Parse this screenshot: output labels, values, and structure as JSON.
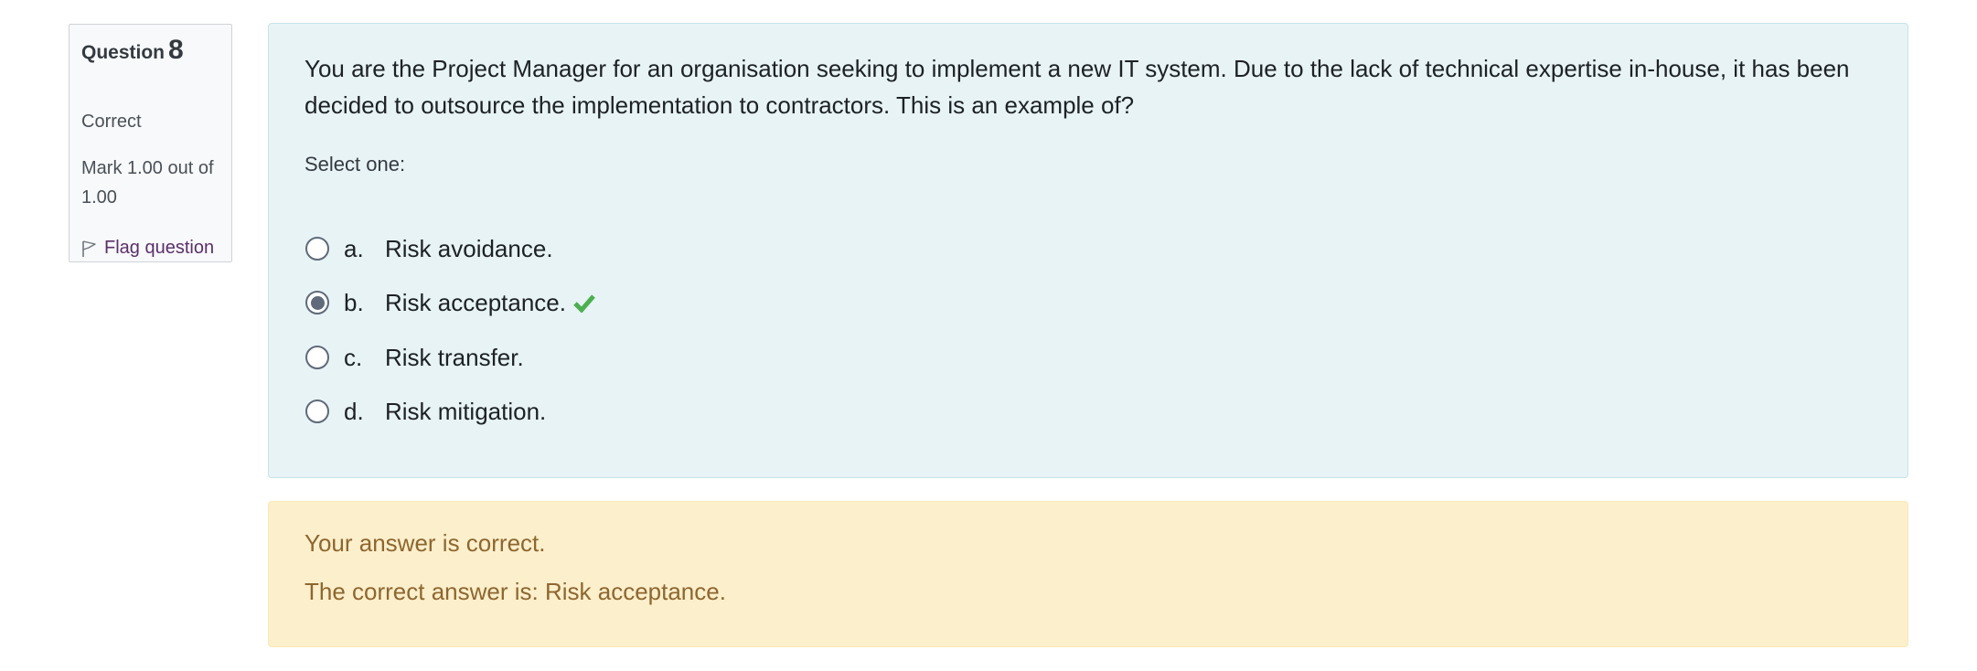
{
  "info": {
    "question_label": "Question",
    "question_number": "8",
    "state": "Correct",
    "grade": "Mark 1.00 out of 1.00",
    "flag_label": "Flag question",
    "flag_icon": "flag-icon"
  },
  "question": {
    "text": "You are the Project Manager for an organisation seeking to implement a new IT system.  Due to the lack of technical expertise in-house, it has been decided to outsource the implementation to contractors. This is an example of?",
    "prompt": "Select one:",
    "options": [
      {
        "letter": "a.",
        "text": "Risk avoidance.",
        "selected": false
      },
      {
        "letter": "b.",
        "text": "Risk acceptance.",
        "selected": true,
        "marked_correct": true
      },
      {
        "letter": "c.",
        "text": "Risk transfer.",
        "selected": false
      },
      {
        "letter": "d.",
        "text": "Risk mitigation.",
        "selected": false
      }
    ],
    "correct_icon": "checkmark-icon"
  },
  "feedback": {
    "status": "Your answer is correct.",
    "right_answer": "The correct answer is: Risk acceptance."
  },
  "colors": {
    "content_bg": "#e7f3f5",
    "feedback_bg": "#fcefcc",
    "feedback_text": "#8e662e",
    "check_green": "#4caf50",
    "flag_link": "#5b2f6b"
  }
}
